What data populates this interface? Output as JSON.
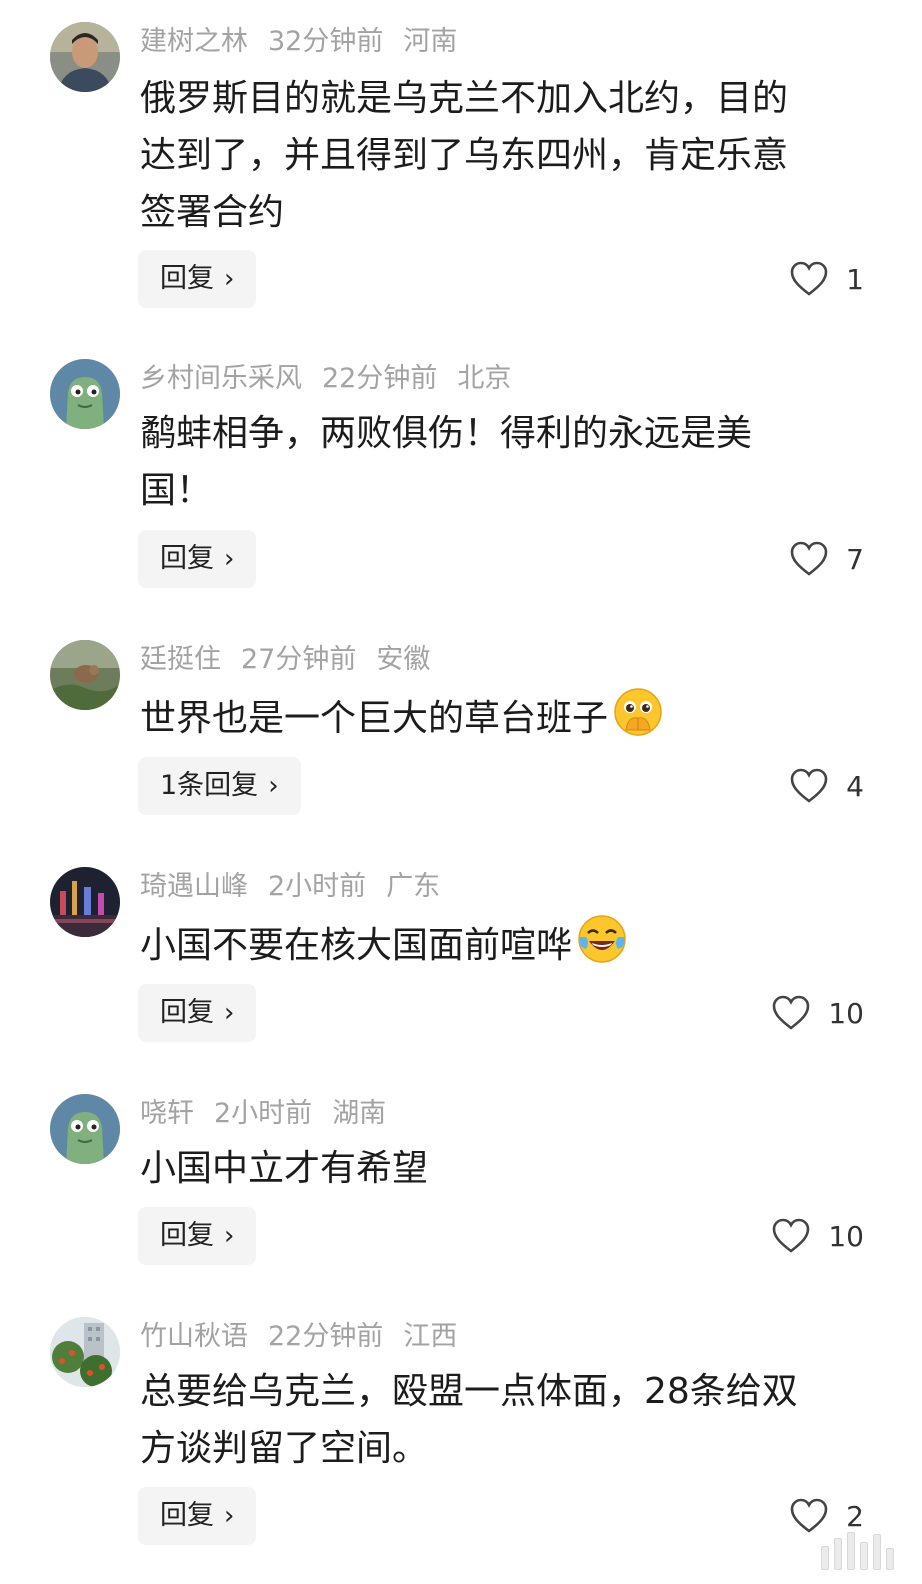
{
  "reply_chevron": "›",
  "comments": [
    {
      "username": "建树之林",
      "time": "32分钟前",
      "location": "河南",
      "lines": [
        "俄罗斯目的就是乌克兰不加入北约，目的",
        "达到了，并且得到了乌东四州，肯定乐意",
        "签署合约"
      ],
      "reply_label": "回复",
      "likes": "1"
    },
    {
      "username": "乡村间乐采风",
      "time": "22分钟前",
      "location": "北京",
      "lines": [
        "鹬蚌相争，两败俱伤！得利的永远是美",
        "国！"
      ],
      "reply_label": "回复",
      "likes": "7"
    },
    {
      "username": "廷挺住",
      "time": "27分钟前",
      "location": "安徽",
      "lines": [
        "世界也是一个巨大的草台班子"
      ],
      "emoji": "pleading-hands-emoji",
      "reply_label": "1条回复",
      "likes": "4"
    },
    {
      "username": "琦遇山峰",
      "time": "2小时前",
      "location": "广东",
      "lines": [
        "小国不要在核大国面前喧哗"
      ],
      "emoji": "tears-of-joy-emoji",
      "reply_label": "回复",
      "likes": "10"
    },
    {
      "username": "哓轩",
      "time": "2小时前",
      "location": "湖南",
      "lines": [
        "小国中立才有希望"
      ],
      "reply_label": "回复",
      "likes": "10"
    },
    {
      "username": "竹山秋语",
      "time": "22分钟前",
      "location": "江西",
      "lines": [
        "总要给乌克兰，殴盟一点体面，28条给双",
        "方谈判留了空间。"
      ],
      "reply_label": "回复",
      "likes": "2"
    }
  ]
}
